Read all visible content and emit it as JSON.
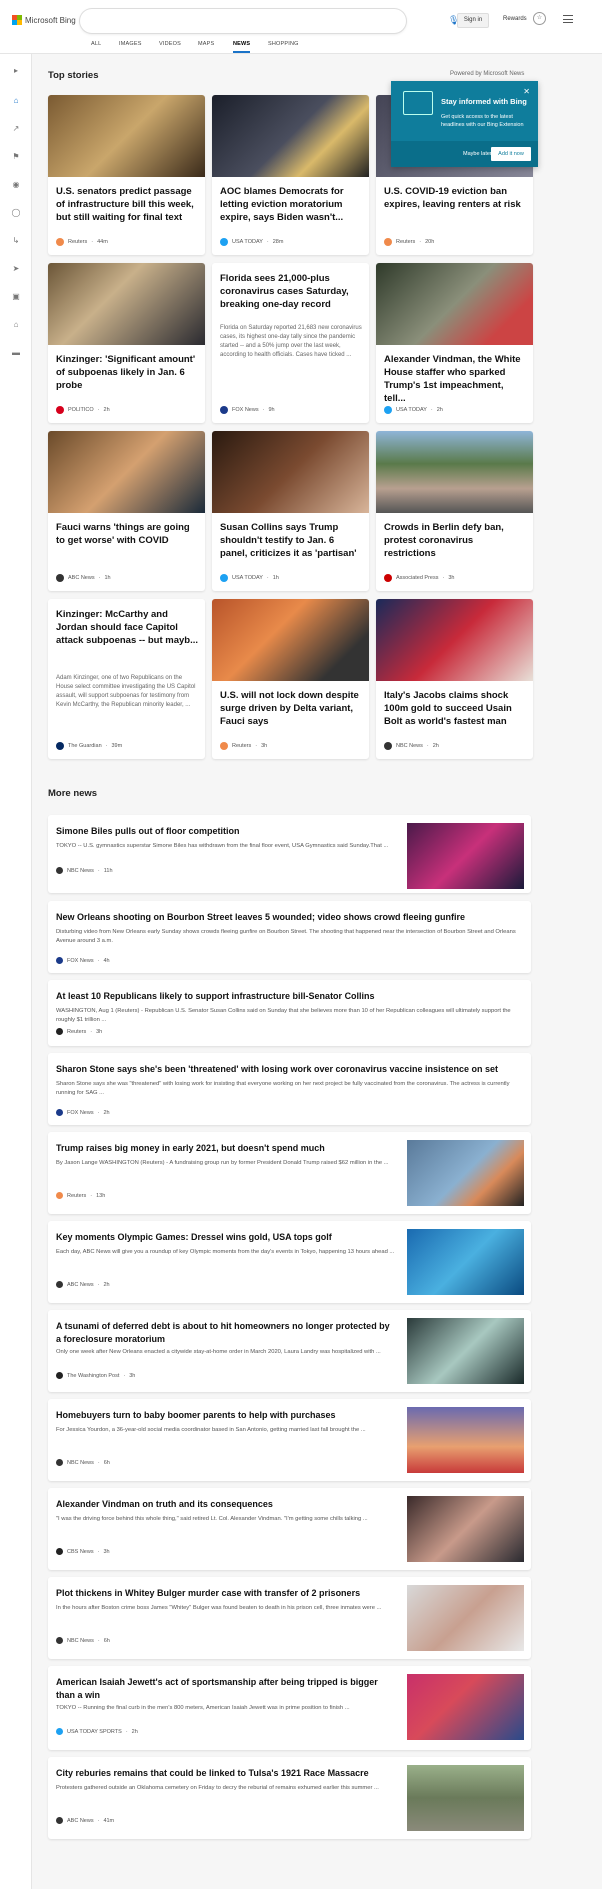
{
  "header": {
    "brand": "Microsoft Bing",
    "search_placeholder": "",
    "sign_in": "Sign in",
    "rewards": "Rewards"
  },
  "tabs": [
    "ALL",
    "IMAGES",
    "VIDEOS",
    "MAPS",
    "NEWS",
    "SHOPPING"
  ],
  "active_tab": "NEWS",
  "sidebar_icons": [
    "expand-icon",
    "home-icon",
    "trending-icon",
    "flag-icon",
    "location-icon",
    "globe-icon",
    "chart-icon",
    "rocket-icon",
    "video-icon",
    "institution-icon",
    "card-icon"
  ],
  "top_stories": {
    "title": "Top stories",
    "powered": "Powered by Microsoft News",
    "cards": [
      {
        "title": "U.S. senators predict passage of infrastructure bill this week, but still waiting for final text",
        "source": "Reuters",
        "time": "44m",
        "color": "#f08a4b"
      },
      {
        "title": "AOC blames Democrats for letting eviction moratorium expire, says Biden wasn't...",
        "source": "USA TODAY",
        "time": "28m",
        "color": "#1da1f2"
      },
      {
        "title": "U.S. COVID-19 eviction ban expires, leaving renters at risk",
        "source": "Reuters",
        "time": "20h",
        "color": "#f08a4b"
      },
      {
        "title": "Kinzinger: 'Significant amount' of subpoenas likely in Jan. 6 probe",
        "source": "POLITICO",
        "time": "2h",
        "color": "#d6001c"
      },
      {
        "title": "Florida sees 21,000-plus coronavirus cases Saturday, breaking one-day record",
        "snippet": "Florida on Saturday reported 21,683 new coronavirus cases, its highest one-day tally since the pandemic started -- and a 50% jump over the last week, according to health officials. Cases have ticked ...",
        "source": "FOX News",
        "time": "9h",
        "color": "#1b3a8a"
      },
      {
        "title": "Alexander Vindman, the White House staffer who sparked Trump's 1st impeachment, tell...",
        "source": "USA TODAY",
        "time": "2h",
        "color": "#1da1f2"
      },
      {
        "title": "Fauci warns 'things are going to get worse' with COVID",
        "source": "ABC News",
        "time": "1h",
        "color": "#333"
      },
      {
        "title": "Susan Collins says Trump shouldn't testify to Jan. 6 panel, criticizes it as 'partisan'",
        "source": "USA TODAY",
        "time": "1h",
        "color": "#1da1f2"
      },
      {
        "title": "Crowds in Berlin defy ban, protest coronavirus restrictions",
        "source": "Associated Press",
        "time": "3h",
        "color": "#c00"
      },
      {
        "title": "Kinzinger: McCarthy and Jordan should face Capitol attack subpoenas -- but mayb...",
        "snippet": "Adam Kinzinger, one of two Republicans on the House select committee investigating the US Capitol assault, will support subpoenas for testimony from Kevin McCarthy, the Republican minority leader, ...",
        "source": "The Guardian",
        "time": "39m",
        "color": "#052962"
      },
      {
        "title": "U.S. will not lock down despite surge driven by Delta variant, Fauci says",
        "source": "Reuters",
        "time": "3h",
        "color": "#f08a4b"
      },
      {
        "title": "Italy's Jacobs claims shock 100m gold to succeed Usain Bolt as world's fastest man",
        "source": "NBC News",
        "time": "2h",
        "color": "#333"
      }
    ]
  },
  "popup": {
    "title": "Stay informed with Bing",
    "desc": "Get quick access to the latest headlines with our Bing Extension",
    "later": "Maybe later",
    "add": "Add it now"
  },
  "more_news": {
    "title": "More news",
    "items": [
      {
        "title": "Simone Biles pulls out of floor competition",
        "desc": "TOKYO -- U.S. gymnastics superstar Simone Biles has withdrawn from the final floor event, USA Gymnastics said Sunday.That ...",
        "source": "NBC News",
        "time": "11h",
        "color": "#333"
      },
      {
        "title": "New Orleans shooting on Bourbon Street leaves 5 wounded; video shows crowd fleeing gunfire",
        "desc": "Disturbing video from New Orleans early Sunday shows crowds fleeing gunfire on Bourbon Street. The shooting that happened near the intersection of Bourbon Street and Orleans Avenue around 3 a.m.",
        "source": "FOX News",
        "time": "4h",
        "color": "#1b3a8a"
      },
      {
        "title": "At least 10 Republicans likely to support infrastructure bill-Senator Collins",
        "desc": "WASHINGTON, Aug 1 (Reuters) - Republican U.S. Senator Susan Collins said on Sunday that she believes more than 10 of her Republican colleagues will ultimately support the roughly $1 trillion ...",
        "source": "Reuters",
        "time": "3h",
        "color": "#222"
      },
      {
        "title": "Sharon Stone says she's been 'threatened' with losing work over coronavirus vaccine insistence on set",
        "desc": "Sharon Stone says she was \"threatened\" with losing work for insisting that everyone working on her next project be fully vaccinated from the coronavirus. The actress is currently running for SAG ...",
        "source": "FOX News",
        "time": "2h",
        "color": "#1b3a8a"
      },
      {
        "title": "Trump raises big money in early 2021, but doesn't spend much",
        "desc": "By Jason Lange WASHINGTON (Reuters) - A fundraising group run by former President Donald Trump raised $62 million in the ...",
        "source": "Reuters",
        "time": "13h",
        "color": "#f08a4b"
      },
      {
        "title": "Key moments Olympic Games: Dressel wins gold, USA tops golf",
        "desc": "Each day, ABC News will give you a roundup of key Olympic moments from the day's events in Tokyo, happening 13 hours ahead ...",
        "source": "ABC News",
        "time": "2h",
        "color": "#333"
      },
      {
        "title": "A tsunami of deferred debt is about to hit homeowners no longer protected by a foreclosure moratorium",
        "desc": "Only one week after New Orleans enacted a citywide stay-at-home order in March 2020, Laura Landry was hospitalized with ...",
        "source": "The Washington Post",
        "time": "3h",
        "color": "#222"
      },
      {
        "title": "Homebuyers turn to baby boomer parents to help with purchases",
        "desc": "For Jessica Yourdon, a 36-year-old social media coordinator based in San Antonio, getting married last fall brought the ...",
        "source": "NBC News",
        "time": "6h",
        "color": "#333"
      },
      {
        "title": "Alexander Vindman on truth and its consequences",
        "desc": "\"I was the driving force behind this whole thing,\" said retired Lt. Col. Alexander Vindman. \"I'm getting some chills talking ...",
        "source": "CBS News",
        "time": "3h",
        "color": "#222"
      },
      {
        "title": "Plot thickens in Whitey Bulger murder case with transfer of 2 prisoners",
        "desc": "In the hours after Boston crime boss James \"Whitey\" Bulger was found beaten to death in his prison cell, three inmates were ...",
        "source": "NBC News",
        "time": "6h",
        "color": "#333"
      },
      {
        "title": "American Isaiah Jewett's act of sportsmanship after being tripped is bigger than a win",
        "desc": "TOKYO -- Running the final curb in the men's 800 meters, American Isaiah Jewett was in prime position to finish ...",
        "source": "USA TODAY SPORTS",
        "time": "2h",
        "color": "#1da1f2"
      },
      {
        "title": "City reburies remains that could be linked to Tulsa's 1921 Race Massacre",
        "desc": "Protesters gathered outside an Oklahoma cemetery on Friday to decry the reburial of remains exhumed earlier this summer ...",
        "source": "ABC News",
        "time": "41m",
        "color": "#333"
      }
    ]
  }
}
